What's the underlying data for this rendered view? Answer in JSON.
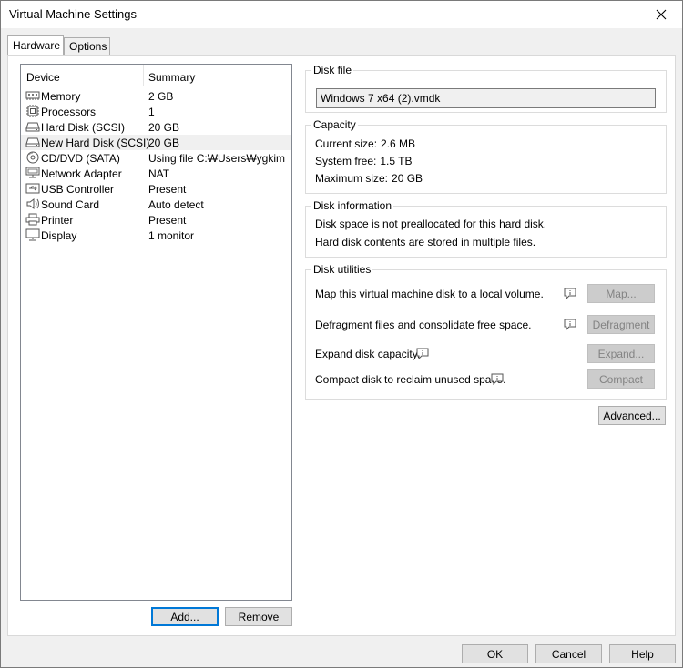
{
  "window": {
    "title": "Virtual Machine Settings"
  },
  "tabs": [
    {
      "label": "Hardware",
      "active": true
    },
    {
      "label": "Options",
      "active": false
    }
  ],
  "device_list": {
    "headers": {
      "device": "Device",
      "summary": "Summary"
    },
    "rows": [
      {
        "icon": "memory-icon",
        "name": "Memory",
        "summary": "2 GB",
        "selected": false
      },
      {
        "icon": "processor-icon",
        "name": "Processors",
        "summary": "1",
        "selected": false
      },
      {
        "icon": "hard-disk-icon",
        "name": "Hard Disk (SCSI)",
        "summary": "20 GB",
        "selected": false
      },
      {
        "icon": "hard-disk-icon",
        "name": "New Hard Disk (SCSI)",
        "summary": "20 GB",
        "selected": true
      },
      {
        "icon": "cd-dvd-icon",
        "name": "CD/DVD (SATA)",
        "summary": "Using file C:₩Users₩ygkim...",
        "selected": false
      },
      {
        "icon": "network-adapter-icon",
        "name": "Network Adapter",
        "summary": "NAT",
        "selected": false
      },
      {
        "icon": "usb-controller-icon",
        "name": "USB Controller",
        "summary": "Present",
        "selected": false
      },
      {
        "icon": "sound-card-icon",
        "name": "Sound Card",
        "summary": "Auto detect",
        "selected": false
      },
      {
        "icon": "printer-icon",
        "name": "Printer",
        "summary": "Present",
        "selected": false
      },
      {
        "icon": "display-icon",
        "name": "Display",
        "summary": "1 monitor",
        "selected": false
      }
    ]
  },
  "list_buttons": {
    "add": "Add...",
    "remove": "Remove"
  },
  "disk_file": {
    "legend": "Disk file",
    "value": "Windows 7 x64 (2).vmdk"
  },
  "capacity": {
    "legend": "Capacity",
    "current_label": "Current size:",
    "current_value": "2.6 MB",
    "free_label": "System free:",
    "free_value": "1.5 TB",
    "max_label": "Maximum size:",
    "max_value": "20 GB"
  },
  "disk_information": {
    "legend": "Disk information",
    "line1": "Disk space is not preallocated for this hard disk.",
    "line2": "Hard disk contents are stored in multiple files."
  },
  "disk_utilities": {
    "legend": "Disk utilities",
    "map_text": "Map this virtual machine disk to a local volume.",
    "map_button": "Map...",
    "defrag_text": "Defragment files and consolidate free space.",
    "defrag_button": "Defragment",
    "expand_text": "Expand disk capacity.",
    "expand_button": "Expand...",
    "compact_text": "Compact disk to reclaim unused space.",
    "compact_button": "Compact"
  },
  "advanced_button": "Advanced...",
  "dialog_buttons": {
    "ok": "OK",
    "cancel": "Cancel",
    "help": "Help"
  },
  "colors": {
    "accent": "#0078d7",
    "selected_row": "#f0f0f0",
    "disabled_button": "#cccccc"
  }
}
